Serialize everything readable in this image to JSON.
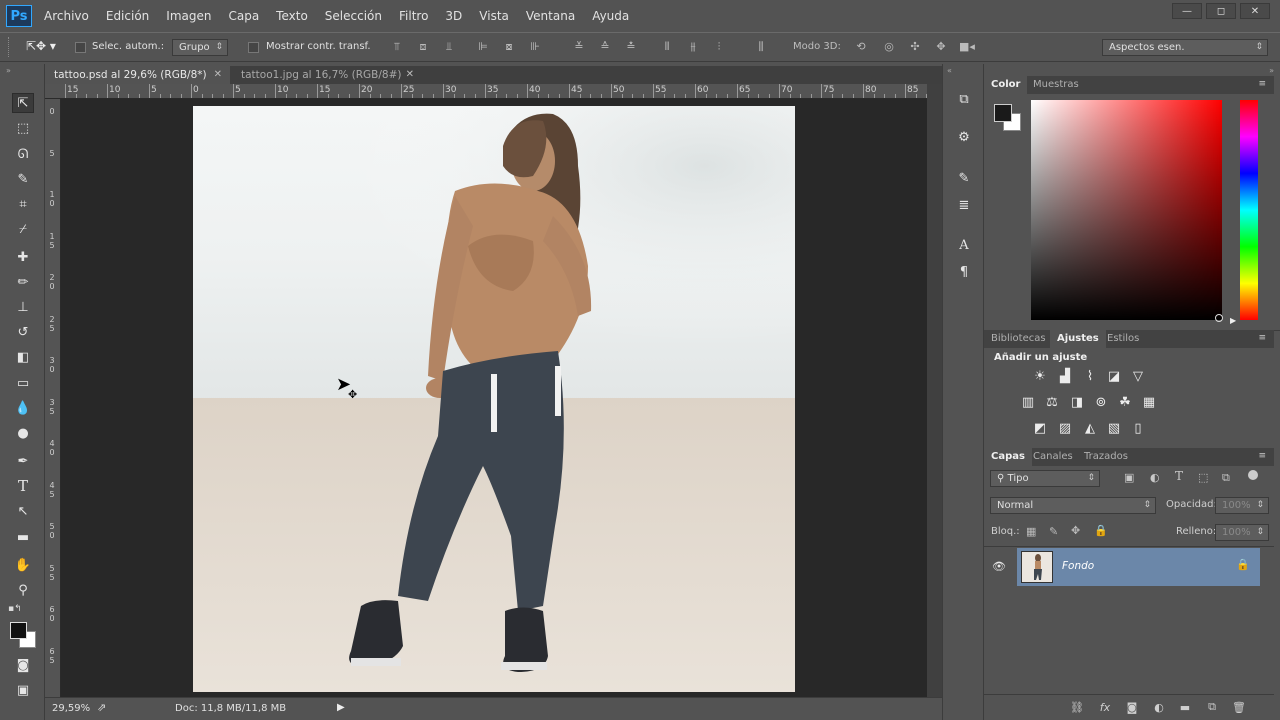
{
  "app": {
    "logo": "Ps"
  },
  "menu": [
    "Archivo",
    "Edición",
    "Imagen",
    "Capa",
    "Texto",
    "Selección",
    "Filtro",
    "3D",
    "Vista",
    "Ventana",
    "Ayuda"
  ],
  "window_controls": {
    "minimize": "—",
    "restore": "◻",
    "close": "✕"
  },
  "options": {
    "auto_select_label": "Selec. autom.:",
    "auto_select_value": "Grupo",
    "transform_label": "Mostrar contr. transf.",
    "mode3d_label": "Modo 3D:",
    "workspace_value": "Aspectos esen."
  },
  "tabs": [
    {
      "label": "tattoo.psd al 29,6% (RGB/8*)",
      "close": "✕",
      "active": true
    },
    {
      "label": "tattoo1.jpg al 16,7% (RGB/8#)",
      "close": "✕",
      "active": false
    }
  ],
  "ruler_top": [
    "15",
    "10",
    "5",
    "0",
    "5",
    "10",
    "15",
    "20",
    "25",
    "30",
    "35",
    "40",
    "45",
    "50",
    "55",
    "60",
    "65",
    "70",
    "75",
    "80",
    "85"
  ],
  "ruler_left": [
    "0",
    "5",
    "1 0",
    "1 5",
    "2 0",
    "2 5",
    "3 0",
    "3 5",
    "4 0",
    "4 5",
    "5 0",
    "5 5",
    "6 0",
    "6 5"
  ],
  "status": {
    "zoom": "29,59%",
    "doc": "Doc: 11,8 MB/11,8 MB"
  },
  "color_panel": {
    "tabs": [
      "Color",
      "Muestras"
    ],
    "foreground": "#1a1a1a",
    "background": "#ffffff",
    "hue": "#ff0000"
  },
  "adjust_panel": {
    "tabs": [
      "Bibliotecas",
      "Ajustes",
      "Estilos"
    ],
    "title": "Añadir un ajuste",
    "icons_row1": [
      "brightness-icon",
      "levels-icon",
      "curves-icon",
      "exposure-icon",
      "vibrance-icon"
    ],
    "icons_row2": [
      "hue-saturation-icon",
      "color-balance-icon",
      "black-white-icon",
      "photo-filter-icon",
      "channel-mixer-icon",
      "color-lookup-icon"
    ],
    "icons_row3": [
      "invert-icon",
      "posterize-icon",
      "threshold-icon",
      "selective-color-icon",
      "gradient-map-icon"
    ]
  },
  "layers_panel": {
    "tabs": [
      "Capas",
      "Canales",
      "Trazados"
    ],
    "filter_value": "Tipo",
    "blend_mode": "Normal",
    "opacity_label": "Opacidad:",
    "opacity_value": "100%",
    "lock_label": "Bloq.:",
    "fill_label": "Relleno:",
    "fill_value": "100%",
    "layers": [
      {
        "name": "Fondo",
        "visible": true,
        "locked": true
      }
    ]
  }
}
